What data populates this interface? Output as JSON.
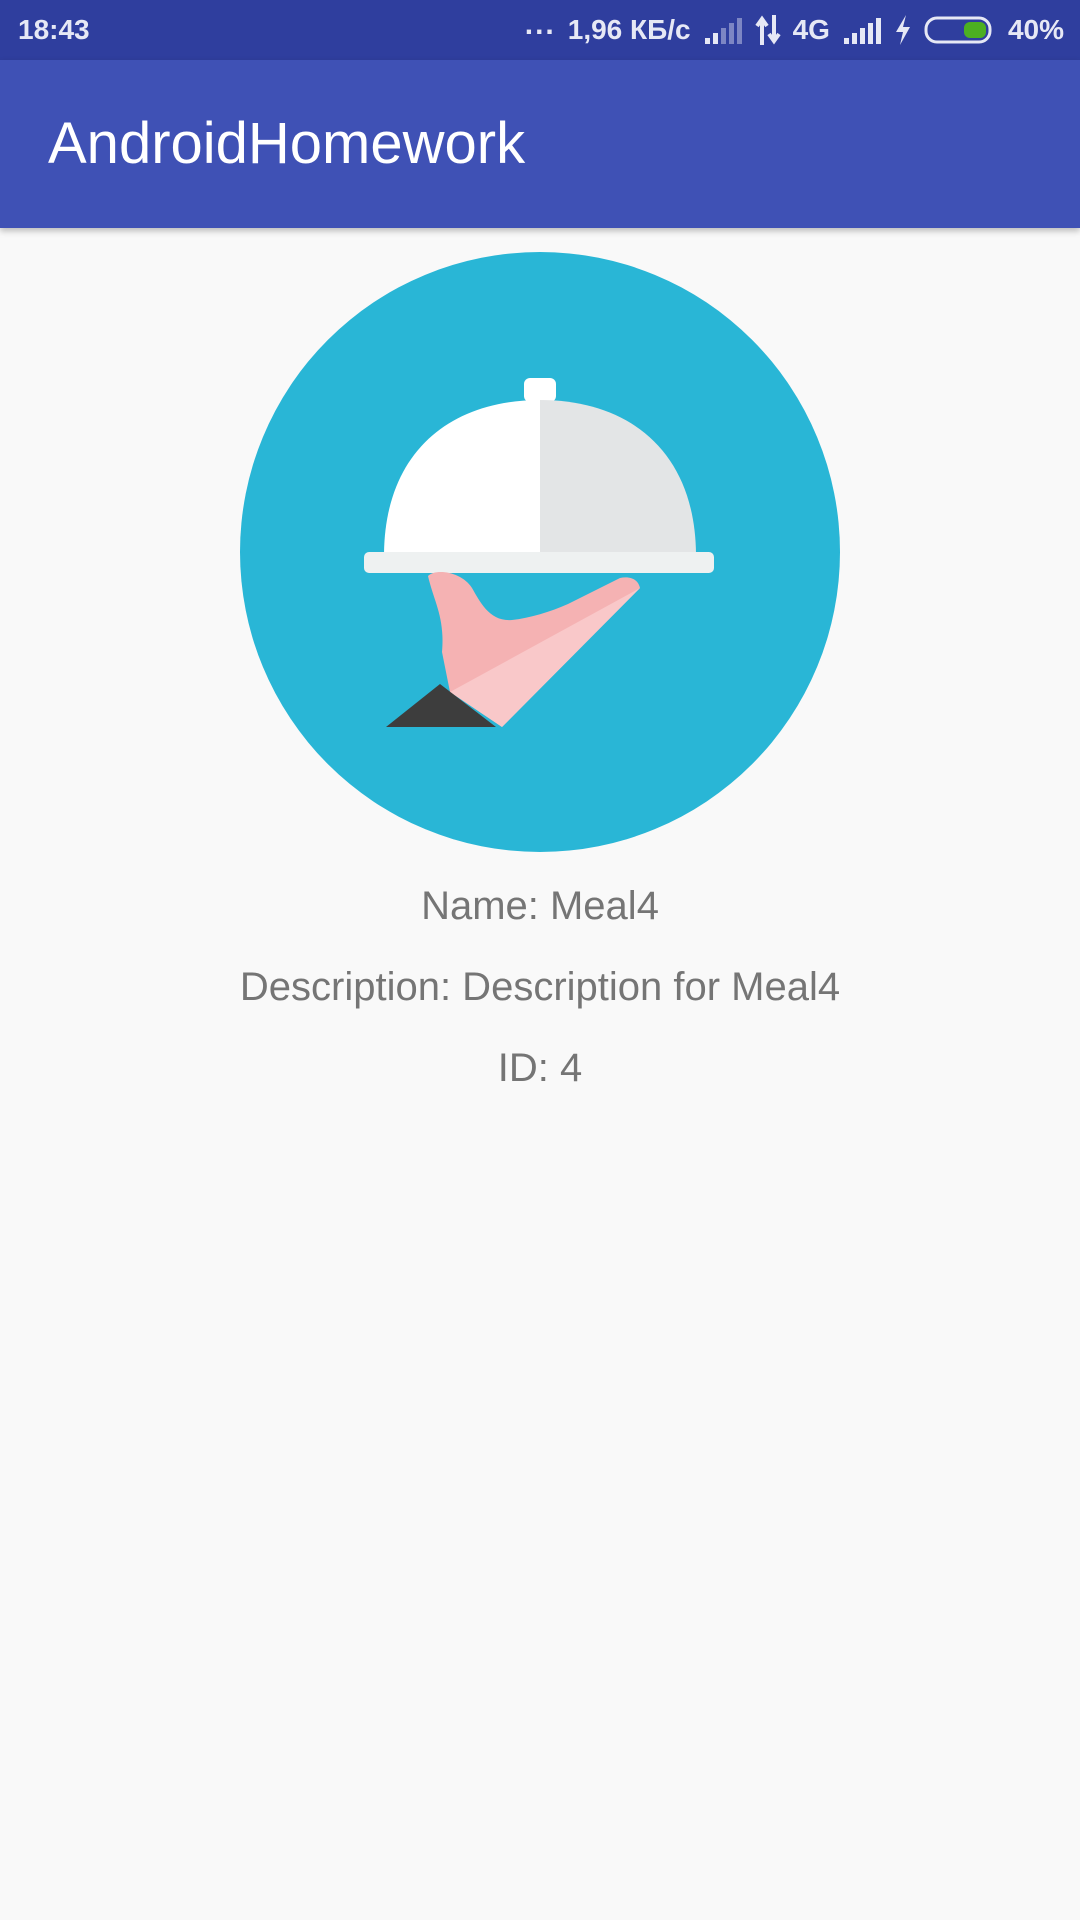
{
  "status_bar": {
    "time": "18:43",
    "more": "...",
    "speed": "1,96 КБ/с",
    "network": "4G",
    "battery": "40%",
    "icons": [
      "signal-weak-icon",
      "data-arrows-icon",
      "signal-full-icon",
      "charging-bolt-icon",
      "battery-icon"
    ],
    "battery_color": "#4caf22"
  },
  "app_bar": {
    "title": "AndroidHomework",
    "color": "#3f51b5"
  },
  "meal": {
    "image_icon": "serving-cloche-icon",
    "image_bg": "#29b6d6",
    "name": "Name: Meal4",
    "description": "Description: Description for Meal4",
    "id": "ID: 4"
  }
}
